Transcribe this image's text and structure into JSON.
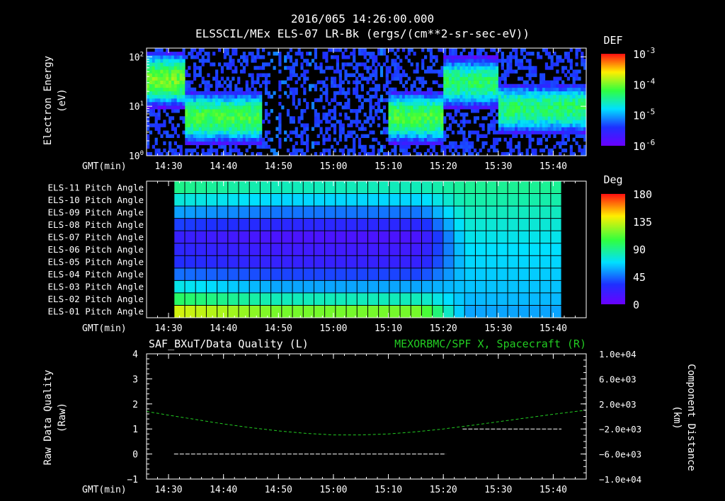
{
  "header": {
    "datetime": "2016/065 14:26:00.000",
    "subtitle": "ELSSCIL/MEx ELS-07 LR-Bk  (ergs/(cm**2-sr-sec-eV))"
  },
  "colors": {
    "background": "#000000",
    "foreground": "#ffffff",
    "quality_line": "#ffffff",
    "spacecraft_x_line": "#22cc22"
  },
  "chart_data": [
    {
      "type": "heatmap",
      "name": "electron-energy-spectrogram",
      "ylabel_line1": "Electron Energy",
      "ylabel_line2": "(eV)",
      "xlabel": "GMT(min)",
      "x_tick_labels": [
        "14:30",
        "14:40",
        "14:50",
        "15:00",
        "15:10",
        "15:20",
        "15:30",
        "15:40"
      ],
      "x_ticks_min": [
        30,
        40,
        50,
        60,
        70,
        80,
        90,
        100
      ],
      "xlim_min": [
        26,
        106
      ],
      "y_scale": "log",
      "ylim": [
        1,
        150
      ],
      "y_ticks": [
        {
          "base": "10",
          "exp": "0"
        },
        {
          "base": "10",
          "exp": "1"
        },
        {
          "base": "10",
          "exp": "2"
        }
      ],
      "colorbar": {
        "title": "DEF",
        "scale": "log",
        "range": [
          1e-06,
          0.001
        ],
        "tick_labels": [
          {
            "base": "10",
            "exp": "-3"
          },
          {
            "base": "10",
            "exp": "-4"
          },
          {
            "base": "10",
            "exp": "-5"
          },
          {
            "base": "10",
            "exp": "-6"
          }
        ]
      },
      "data_gaps_min": [
        [
          48.5,
          49.8
        ],
        [
          50.6,
          51.6
        ],
        [
          55.5,
          56.3
        ],
        [
          68.5,
          69.1
        ]
      ],
      "energy_bands": [
        {
          "t": [
            26,
            33
          ],
          "center_eV": 35,
          "intensity": 0.0001
        },
        {
          "t": [
            33,
            47
          ],
          "center_eV": 6,
          "intensity": 7e-05
        },
        {
          "t": [
            70,
            80
          ],
          "center_eV": 6,
          "intensity": 7e-05
        },
        {
          "t": [
            80,
            90
          ],
          "center_eV": 30,
          "intensity": 5e-05
        },
        {
          "t": [
            90,
            106
          ],
          "center_eV": 9,
          "intensity": 5e-05
        }
      ]
    },
    {
      "type": "heatmap",
      "name": "pitch-angle-grid",
      "xlabel": "GMT(min)",
      "x_tick_labels": [
        "14:30",
        "14:40",
        "14:50",
        "15:00",
        "15:10",
        "15:20",
        "15:30",
        "15:40"
      ],
      "x_ticks_min": [
        30,
        40,
        50,
        60,
        70,
        80,
        90,
        100
      ],
      "xlim_min": [
        26,
        106
      ],
      "data_range_min": [
        31,
        101.5
      ],
      "n_time_bins": 36,
      "row_labels": [
        "ELS-11 Pitch Angle",
        "ELS-10 Pitch Angle",
        "ELS-09 Pitch Angle",
        "ELS-08 Pitch Angle",
        "ELS-07 Pitch Angle",
        "ELS-06 Pitch Angle",
        "ELS-05 Pitch Angle",
        "ELS-04 Pitch Angle",
        "ELS-03 Pitch Angle",
        "ELS-02 Pitch Angle",
        "ELS-01 Pitch Angle"
      ],
      "colorbar": {
        "title": "Deg",
        "range": [
          0,
          180
        ],
        "tick_labels": [
          "180",
          "135",
          "90",
          "45",
          "0"
        ]
      },
      "pitch_deg_early": [
        85,
        70,
        50,
        30,
        15,
        20,
        25,
        40,
        60,
        85,
        120
      ],
      "pitch_deg_late": [
        92,
        88,
        84,
        80,
        76,
        72,
        70,
        68,
        66,
        64,
        60
      ],
      "transition_min": [
        76,
        84
      ]
    },
    {
      "type": "line",
      "name": "data-quality-and-component-distance",
      "title_left": "SAF_BXuT/Data Quality (L)",
      "title_right": "MEXORBMC/SPF X, Spacecraft (R)",
      "ylabel_left_line1": "Raw Data Quality",
      "ylabel_left_line2": "(Raw)",
      "ylabel_right_line1": "Component Distance",
      "ylabel_right_line2": "(km)",
      "xlabel": "GMT(min)",
      "x_tick_labels": [
        "14:30",
        "14:40",
        "14:50",
        "15:00",
        "15:10",
        "15:20",
        "15:30",
        "15:40"
      ],
      "x_ticks_min": [
        30,
        40,
        50,
        60,
        70,
        80,
        90,
        100
      ],
      "xlim_min": [
        26,
        106
      ],
      "ylim_left": [
        -1,
        4
      ],
      "y_ticks_left": [
        "4",
        "3",
        "2",
        "1",
        "0",
        "−1"
      ],
      "ylim_right": [
        -10000,
        10000
      ],
      "y_ticks_right": [
        "1.0e+04",
        "6.0e+03",
        "2.0e+03",
        "−2.0e+03",
        "−6.0e+03",
        "−1.0e+04"
      ],
      "series": [
        {
          "axis": "left",
          "segments": [
            {
              "x": [
                31,
                80.5
              ],
              "y": [
                0,
                0
              ]
            },
            {
              "x": [
                83.5,
                101.5
              ],
              "y": [
                1,
                1
              ]
            }
          ]
        },
        {
          "axis": "right",
          "x": [
            26,
            30,
            35,
            40,
            45,
            50,
            55,
            60,
            65,
            70,
            75,
            80,
            85,
            90,
            95,
            100,
            106
          ],
          "y": [
            800,
            200,
            -500,
            -1200,
            -1800,
            -2300,
            -2700,
            -2950,
            -2950,
            -2800,
            -2450,
            -2000,
            -1450,
            -850,
            -250,
            350,
            1000
          ]
        }
      ]
    }
  ]
}
